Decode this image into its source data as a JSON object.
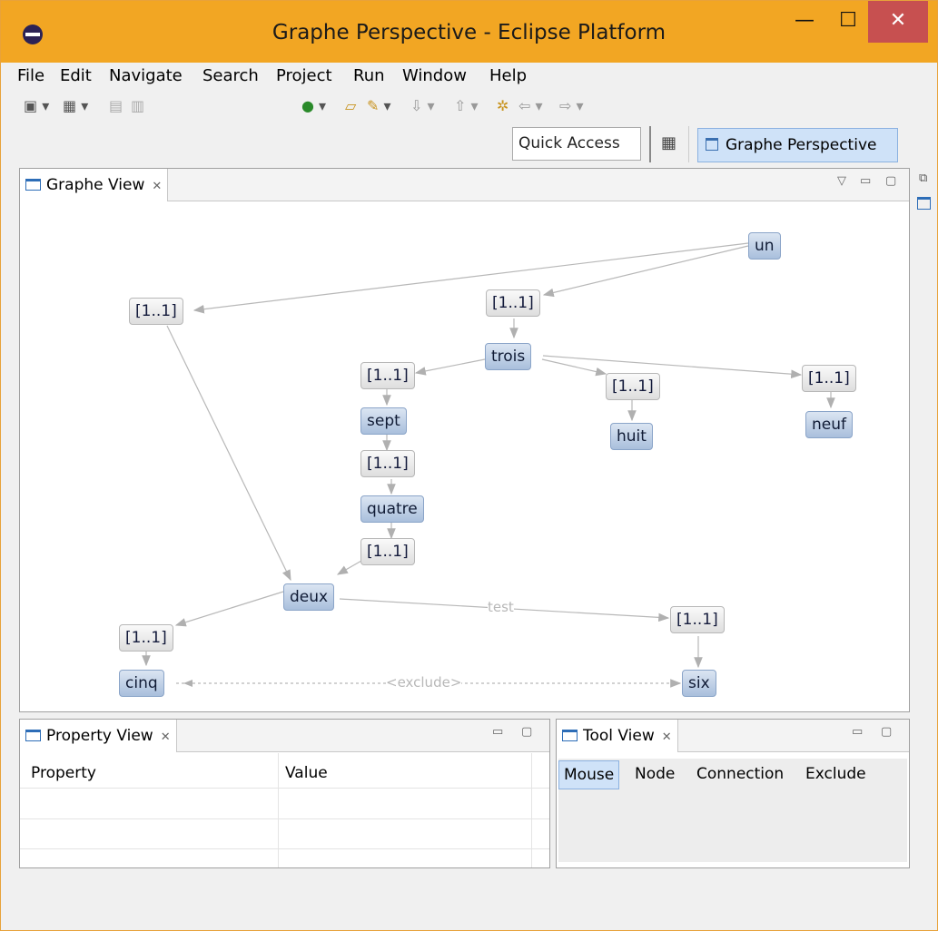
{
  "window": {
    "title": "Graphe Perspective - Eclipse Platform",
    "min": "—",
    "max": "☐",
    "close": "✕"
  },
  "menu": [
    "File",
    "Edit",
    "Navigate",
    "Search",
    "Project",
    "Run",
    "Window",
    "Help"
  ],
  "toolbar": {
    "quick_access": "Quick Access",
    "perspective": "Graphe Perspective"
  },
  "graph_view": {
    "tab": "Graphe View",
    "nodes": {
      "un": "un",
      "trois": "trois",
      "sept": "sept",
      "quatre": "quatre",
      "deux": "deux",
      "huit": "huit",
      "neuf": "neuf",
      "cinq": "cinq",
      "six": "six",
      "c1": "[1..1]",
      "c2": "[1..1]",
      "c3": "[1..1]",
      "c4": "[1..1]",
      "c5": "[1..1]",
      "c6": "[1..1]",
      "c7": "[1..1]",
      "c8": "[1..1]",
      "c9": "[1..1]"
    },
    "edge_labels": {
      "test": "test",
      "exclude": "<exclude>"
    }
  },
  "property_view": {
    "tab": "Property View",
    "col_property": "Property",
    "col_value": "Value"
  },
  "tool_view": {
    "tab": "Tool View",
    "tools": [
      "Mouse",
      "Node",
      "Connection",
      "Exclude"
    ],
    "selected": "Mouse"
  }
}
